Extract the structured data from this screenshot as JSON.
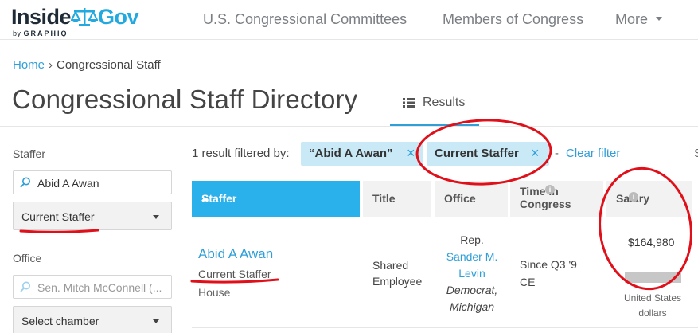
{
  "header": {
    "logo_prefix": "Inside",
    "logo_suffix": "Gov",
    "logo_by": "by",
    "logo_company": "GRAPHIQ",
    "nav": [
      {
        "label": "U.S. Congressional Committees"
      },
      {
        "label": "Members of Congress"
      },
      {
        "label": "More"
      }
    ]
  },
  "breadcrumb": {
    "home": "Home",
    "separator": "›",
    "current": "Congressional Staff"
  },
  "page_title": "Congressional Staff Directory",
  "tab": {
    "label": "Results",
    "icon": "list-icon"
  },
  "sidebar": {
    "staffer_label": "Staffer",
    "staffer_search_value": "Abid A Awan",
    "staffer_status_select": "Current Staffer",
    "office_label": "Office",
    "office_search_placeholder": "Sen. Mitch McConnell (...",
    "chamber_select": "Select chamber"
  },
  "filters": {
    "summary": "1 result filtered by:",
    "chips": [
      {
        "label": "“Abid A Awan”",
        "remove": "×"
      },
      {
        "label": "Current Staffer",
        "remove": "×"
      }
    ],
    "dash": "-",
    "clear": "Clear filter",
    "edge_char": "S"
  },
  "table": {
    "columns": {
      "staffer": "Staffer",
      "title": "Title",
      "office": "Office",
      "time_line1": "Time in",
      "time_line2": "Congress",
      "salary": "Salary"
    },
    "rows": [
      {
        "name": "Abid A Awan",
        "status": "Current Staffer",
        "chamber": "House",
        "title_line1": "Shared",
        "title_line2": "Employee",
        "office_prefix": "Rep.",
        "office_name_line1": "Sander M.",
        "office_name_line2": "Levin",
        "office_party": "Democrat,",
        "office_state": "Michigan",
        "time_line1": "Since Q3 '9",
        "time_line2": "CE",
        "salary": "$164,980",
        "salary_unit_line1": "United States",
        "salary_unit_line2": "dollars"
      }
    ]
  },
  "colors": {
    "accent": "#2f9fd8",
    "header_active": "#2ab0ea",
    "chip_bg": "#c9e9f7",
    "annotation": "#e0101a"
  }
}
